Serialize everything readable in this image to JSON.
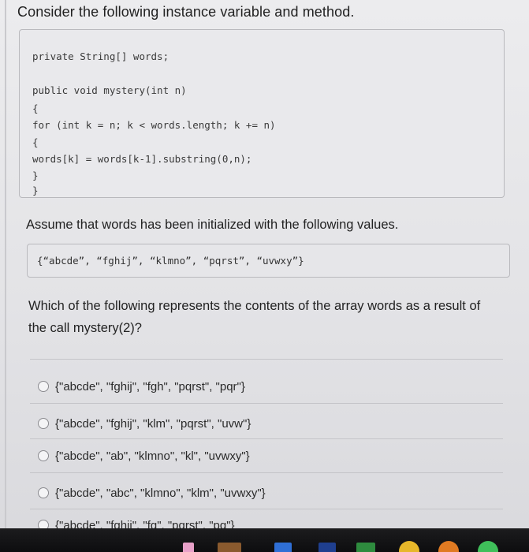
{
  "question": {
    "title": "Consider the following instance variable and method."
  },
  "code": {
    "lines": [
      "private String[] words;",
      "public void mystery(int n)",
      "{",
      "for (int k = n; k < words.length; k += n)",
      "{",
      "words[k] = words[k-1].substring(0,n);",
      "}",
      "}"
    ]
  },
  "assume_text": "Assume that words has been initialized with the following values.",
  "initial_values": "{“abcde”, “fghij”, “klmno”, “pqrst”, “uvwxy”}",
  "prompt": "Which of the following represents the contents of the array words as a result of the call mystery(2)?",
  "options": [
    {
      "label": "{\"abcde\", \"fghij\", \"fgh\", \"pqrst\", \"pqr\"}",
      "selected": false
    },
    {
      "label": "{\"abcde\", \"fghij\", \"klm\", \"pqrst\", \"uvw\"}",
      "selected": false
    },
    {
      "label": "{\"abcde\", \"ab\", \"klmno\", \"kl\", \"uvwxy\"}",
      "selected": false
    },
    {
      "label": "{\"abcde\", \"abc\", \"klmno\", \"klm\", \"uvwxy\"}",
      "selected": false
    },
    {
      "label": "{\"abcde\", \"fghij\", \"fg\", \"pqrst\", \"pq\"}",
      "selected": false
    }
  ],
  "taskbar": {
    "icons": [
      {
        "name": "app-icon-pink",
        "color": "#e8a0c8"
      },
      {
        "name": "app-icon-brown",
        "color": "#8a5a2e"
      },
      {
        "name": "app-icon-blue",
        "color": "#2f6fd6"
      },
      {
        "name": "app-icon-dark-blue",
        "color": "#1f3f8f"
      },
      {
        "name": "app-icon-green",
        "color": "#2e8b3e"
      },
      {
        "name": "app-icon-yellow",
        "color": "#e7b72a"
      },
      {
        "name": "app-icon-orange",
        "color": "#e07a22"
      },
      {
        "name": "app-icon-white-green",
        "color": "#3fbf5a"
      }
    ]
  }
}
